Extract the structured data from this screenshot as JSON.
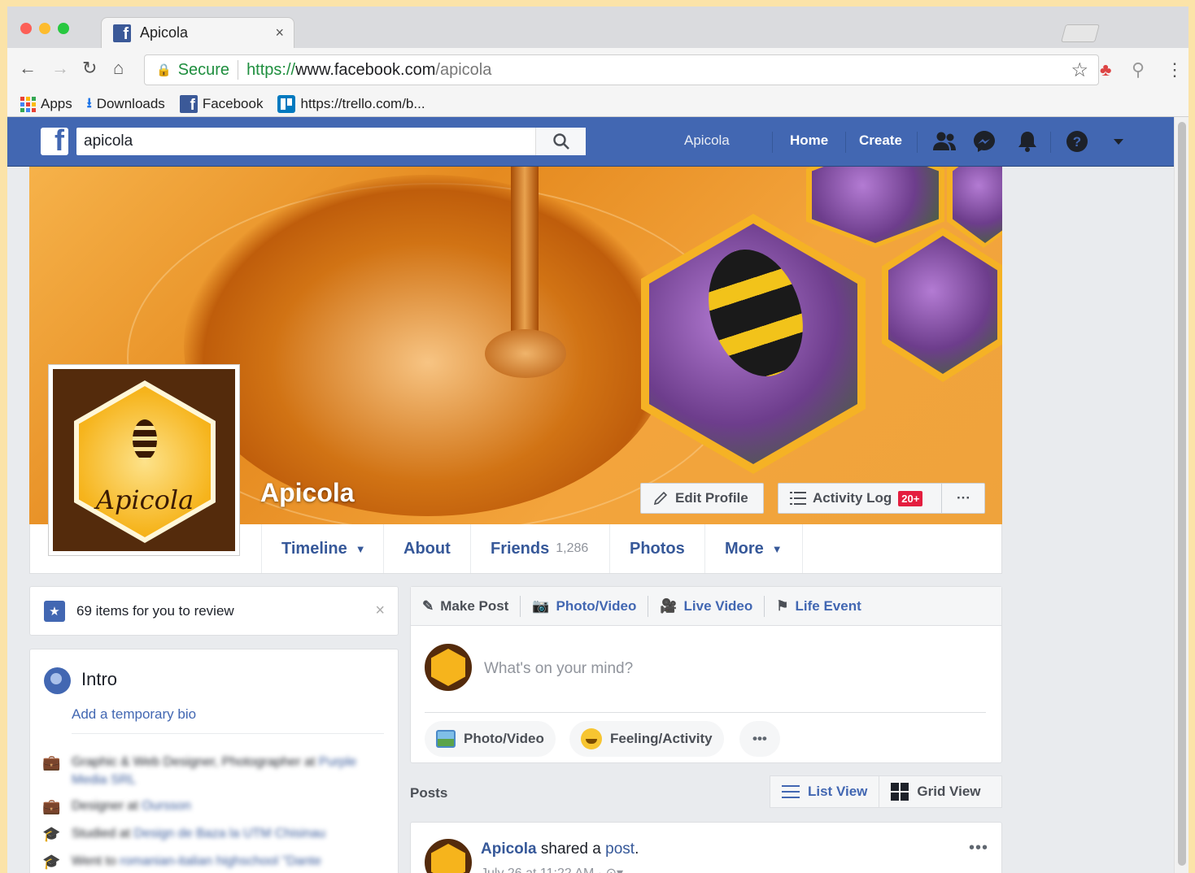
{
  "browser": {
    "tab_title": "Apicola",
    "tab_close": "×",
    "secure_label": "Secure",
    "url_scheme": "https://",
    "url_host": "www.facebook.com",
    "url_path": "/apicola",
    "bookmarks": [
      {
        "label": "Apps"
      },
      {
        "label": "Downloads"
      },
      {
        "label": "Facebook"
      },
      {
        "label": "https://trello.com/b..."
      }
    ]
  },
  "fb_header": {
    "search_value": "apicola",
    "nav": {
      "page": "Apicola",
      "home": "Home",
      "create": "Create"
    }
  },
  "profile": {
    "page_name": "Apicola",
    "logo_text": "Apicola",
    "edit_profile": "Edit Profile",
    "activity_log": "Activity Log",
    "activity_badge": "20+",
    "more_dots": "···",
    "tabs": [
      {
        "label": "Timeline"
      },
      {
        "label": "About"
      },
      {
        "label": "Friends",
        "count": "1,286"
      },
      {
        "label": "Photos"
      },
      {
        "label": "More"
      }
    ]
  },
  "review": {
    "text": "69 items for you to review",
    "close": "×"
  },
  "intro": {
    "title": "Intro",
    "add_bio": "Add a temporary bio",
    "items": [
      {
        "text": "Graphic & Web Designer, Photographer at",
        "link": "Purple Media SRL"
      },
      {
        "text": "Designer at",
        "link": "Oursson"
      },
      {
        "text": "Studied at",
        "link": "Design de Baza la UTM Chisinau"
      },
      {
        "text": "Went to",
        "link": "romanian-italian highschool \"Dante"
      }
    ]
  },
  "composer": {
    "tabs": [
      {
        "label": "Make Post"
      },
      {
        "label": "Photo/Video"
      },
      {
        "label": "Live Video"
      },
      {
        "label": "Life Event"
      }
    ],
    "placeholder": "What's on your mind?",
    "actions": {
      "photo": "Photo/Video",
      "feeling": "Feeling/Activity",
      "more": "•••"
    }
  },
  "posts": {
    "title": "Posts",
    "list_view": "List View",
    "grid_view": "Grid View",
    "first": {
      "author": "Apicola",
      "verb": "shared a",
      "object": "post",
      "date": "July 26 at 11:22 AM · ",
      "more": "•••"
    }
  },
  "colors": {
    "fb_blue": "#4267b2",
    "link_blue": "#365899",
    "badge_red": "#e41e3f",
    "honey": "#e58a1f"
  }
}
